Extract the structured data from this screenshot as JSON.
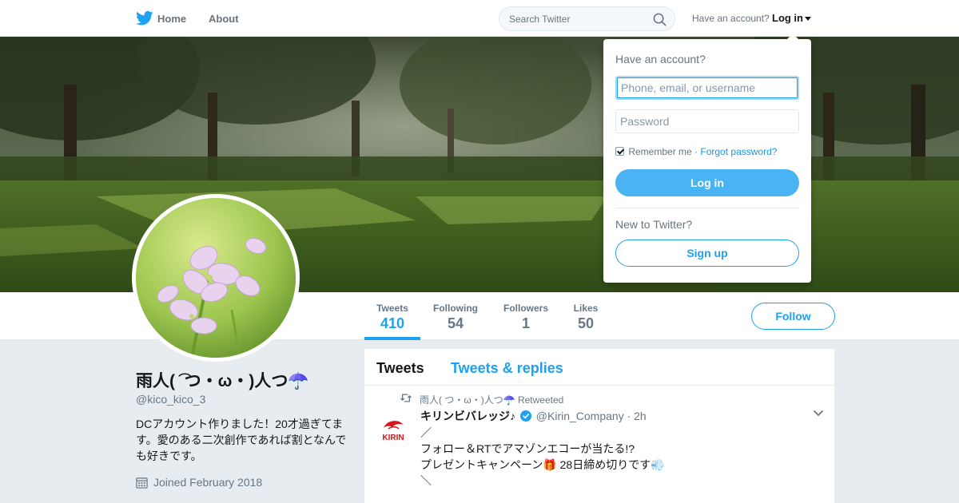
{
  "nav": {
    "home_label": "Home",
    "about_label": "About",
    "search_placeholder": "Search Twitter",
    "have_account": "Have an account?",
    "login_label": "Log in"
  },
  "colors": {
    "accent": "#1da1f2",
    "login_button": "#4ab3f4",
    "background": "#e6ecf0"
  },
  "profile": {
    "name": "雨人( ͡ つ・ω・)人つ☂️",
    "handle": "@kico_kico_3",
    "bio": "DCアカウント作りました！20才過ぎてます。愛のある二次創作であれば割となんでも好きです。",
    "joined": "Joined February 2018",
    "follow_label": "Follow"
  },
  "stats": [
    {
      "label": "Tweets",
      "value": "410",
      "active": true
    },
    {
      "label": "Following",
      "value": "54",
      "active": false
    },
    {
      "label": "Followers",
      "value": "1",
      "active": false
    },
    {
      "label": "Likes",
      "value": "50",
      "active": false
    }
  ],
  "timeline": {
    "tabs": [
      "Tweets",
      "Tweets & replies"
    ],
    "tweet": {
      "retweeted_by": "雨人( つ・ω・)人つ☂️ Retweeted",
      "author_name": "キリンビバレッジ♪",
      "author_handle": "@Kirin_Company",
      "time": "· 2h",
      "avatar_text": "KIRIN",
      "lines": [
        "／",
        "フォロー＆RTでアマゾンエコーが当たる!?",
        "プレゼントキャンペーン🎁 28日締め切りです💨",
        "＼"
      ]
    }
  },
  "login_dropdown": {
    "title": "Have an account?",
    "username_placeholder": "Phone, email, or username",
    "password_placeholder": "Password",
    "remember_label": "Remember me",
    "separator": " · ",
    "forgot_label": "Forgot password?",
    "login_button": "Log in",
    "new_to_twitter": "New to Twitter?",
    "signup_button": "Sign up"
  }
}
